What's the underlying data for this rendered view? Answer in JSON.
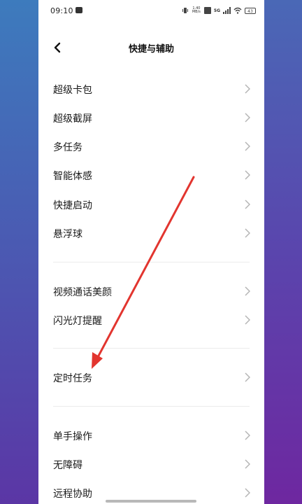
{
  "status_bar": {
    "time": "09:10",
    "network_speed": "1.40\nMB/s",
    "network_type": "5G",
    "battery": "43"
  },
  "header": {
    "title": "快捷与辅助"
  },
  "groups": [
    {
      "items": [
        {
          "label": "超级卡包"
        },
        {
          "label": "超级截屏"
        },
        {
          "label": "多任务"
        },
        {
          "label": "智能体感"
        },
        {
          "label": "快捷启动"
        },
        {
          "label": "悬浮球"
        }
      ]
    },
    {
      "items": [
        {
          "label": "视频通话美颜"
        },
        {
          "label": "闪光灯提醒"
        }
      ]
    },
    {
      "items": [
        {
          "label": "定时任务"
        }
      ]
    },
    {
      "items": [
        {
          "label": "单手操作"
        },
        {
          "label": "无障碍"
        },
        {
          "label": "远程协助"
        }
      ]
    }
  ],
  "colors": {
    "annotation_arrow": "#e2352f",
    "background_top": "#3f6fb8",
    "background_bottom": "#6a2fa3"
  }
}
